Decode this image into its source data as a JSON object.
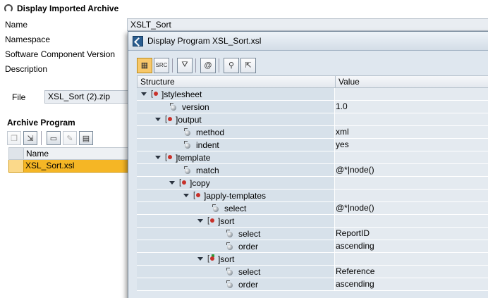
{
  "background": {
    "title": "Display Imported Archive",
    "fields": {
      "name_label": "Name",
      "name_value": "XSLT_Sort",
      "namespace_label": "Namespace",
      "software_component_label": "Software Component Version",
      "description_label": "Description",
      "file_label": "File",
      "file_value": "XSL_Sort (2).zip"
    },
    "archive_program": {
      "title": "Archive Program",
      "column_header": "Name",
      "rows": [
        "XSL_Sort.xsl"
      ]
    }
  },
  "dialog": {
    "title": "Display Program XSL_Sort.xsl",
    "columns": {
      "structure": "Structure",
      "value": "Value"
    },
    "tree": [
      {
        "indent": 0,
        "kind": "element",
        "expanded": true,
        "label": "stylesheet",
        "value": ""
      },
      {
        "indent": 2,
        "kind": "attribute",
        "label": "version",
        "value": "1.0"
      },
      {
        "indent": 1,
        "kind": "element",
        "expanded": true,
        "label": "output",
        "value": ""
      },
      {
        "indent": 3,
        "kind": "attribute",
        "label": "method",
        "value": "xml"
      },
      {
        "indent": 3,
        "kind": "attribute",
        "label": "indent",
        "value": "yes"
      },
      {
        "indent": 1,
        "kind": "element",
        "expanded": true,
        "label": "template",
        "value": ""
      },
      {
        "indent": 3,
        "kind": "attribute",
        "label": "match",
        "value": "@*|node()"
      },
      {
        "indent": 2,
        "kind": "element",
        "expanded": true,
        "label": "copy",
        "value": ""
      },
      {
        "indent": 3,
        "kind": "element",
        "expanded": true,
        "label": "apply-templates",
        "value": ""
      },
      {
        "indent": 5,
        "kind": "attribute",
        "label": "select",
        "value": "@*|node()"
      },
      {
        "indent": 4,
        "kind": "element",
        "expanded": true,
        "label": "sort",
        "value": ""
      },
      {
        "indent": 6,
        "kind": "attribute",
        "label": "select",
        "value": "ReportID"
      },
      {
        "indent": 6,
        "kind": "attribute",
        "label": "order",
        "value": "ascending"
      },
      {
        "indent": 4,
        "kind": "element",
        "expanded": true,
        "green": true,
        "label": "sort",
        "value": ""
      },
      {
        "indent": 6,
        "kind": "attribute",
        "label": "select",
        "value": "Reference"
      },
      {
        "indent": 6,
        "kind": "attribute",
        "label": "order",
        "value": "ascending"
      }
    ]
  }
}
